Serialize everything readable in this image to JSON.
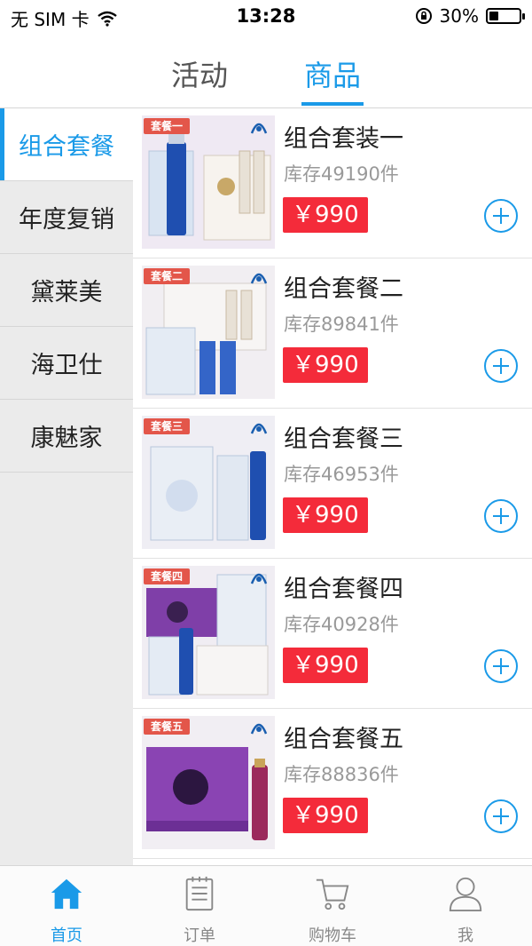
{
  "status_bar": {
    "carrier": "无 SIM 卡",
    "time": "13:28",
    "battery": "30%",
    "battery_level": 0.3
  },
  "top_tabs": [
    {
      "label": "活动",
      "active": false
    },
    {
      "label": "商品",
      "active": true
    }
  ],
  "sidebar": {
    "items": [
      {
        "label": "组合套餐",
        "active": true
      },
      {
        "label": "年度复销",
        "active": false
      },
      {
        "label": "黛莱美",
        "active": false
      },
      {
        "label": "海卫仕",
        "active": false
      },
      {
        "label": "康魅家",
        "active": false
      }
    ]
  },
  "products": [
    {
      "tag": "套餐一",
      "name": "组合套装一",
      "stock": "库存49190件",
      "price": "￥990"
    },
    {
      "tag": "套餐二",
      "name": "组合套餐二",
      "stock": "库存89841件",
      "price": "￥990"
    },
    {
      "tag": "套餐三",
      "name": "组合套餐三",
      "stock": "库存46953件",
      "price": "￥990"
    },
    {
      "tag": "套餐四",
      "name": "组合套餐四",
      "stock": "库存40928件",
      "price": "￥990"
    },
    {
      "tag": "套餐五",
      "name": "组合套餐五",
      "stock": "库存88836件",
      "price": "￥990"
    }
  ],
  "bottom_nav": [
    {
      "label": "首页",
      "icon": "home-icon",
      "active": true
    },
    {
      "label": "订单",
      "icon": "order-icon",
      "active": false
    },
    {
      "label": "购物车",
      "icon": "cart-icon",
      "active": false
    },
    {
      "label": "我",
      "icon": "user-icon",
      "active": false
    }
  ],
  "colors": {
    "accent": "#1a9ae8",
    "price_bg": "#f42b3a",
    "tag_bg": "#e3564a"
  }
}
